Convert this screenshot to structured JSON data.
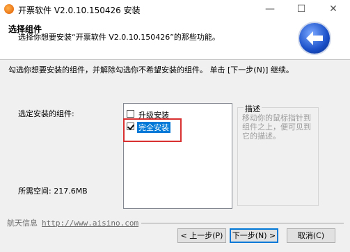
{
  "window": {
    "title": "开票软件 V2.0.10.150426 安装",
    "controls": {
      "minimize": "—",
      "maximize": "☐",
      "close": "✕"
    }
  },
  "header": {
    "title": "选择组件",
    "subtitle": "选择你想要安装“开票软件 V2.0.10.150426”的那些功能。"
  },
  "instructions": "勾选你想要安装的组件，并解除勾选你不希望安装的组件。 单击 [下一步(N)] 继续。",
  "components": {
    "label": "选定安装的组件:",
    "items": [
      {
        "label": "升级安装",
        "checked": false,
        "selected": false
      },
      {
        "label": "完全安装",
        "checked": true,
        "selected": true
      }
    ]
  },
  "description": {
    "title": "描述",
    "text": "移动你的鼠标指针到组件之上，便可见到它的描述。"
  },
  "space_required": "所需空间: 217.6MB",
  "footer": {
    "brand": "航天信息",
    "url": "http://www.aisino.com"
  },
  "buttons": {
    "back": "< 上一步(P)",
    "next": "下一步(N) >",
    "cancel": "取消(C)"
  }
}
